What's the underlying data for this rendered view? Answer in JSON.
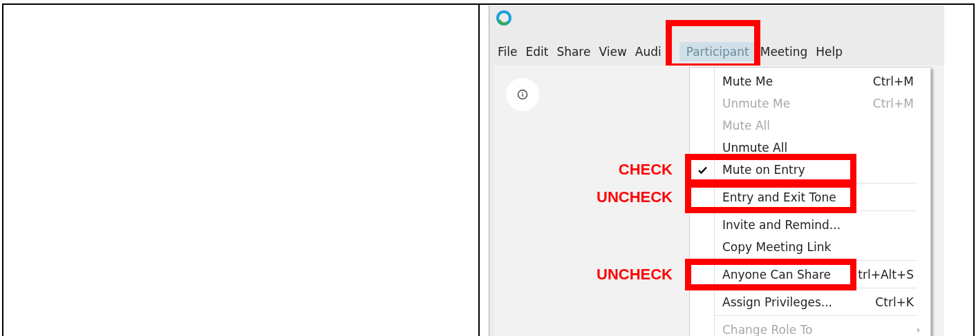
{
  "app": {
    "menu_bar": [
      {
        "label": "File",
        "selected": false,
        "highlighted": false
      },
      {
        "label": "Edit",
        "selected": false,
        "highlighted": false
      },
      {
        "label": "Share",
        "selected": false,
        "highlighted": false
      },
      {
        "label": "View",
        "selected": false,
        "highlighted": false
      },
      {
        "label": "Audi",
        "selected": false,
        "highlighted": false
      },
      {
        "label": "Participant",
        "selected": true,
        "highlighted": true
      },
      {
        "label": "Meeting",
        "selected": false,
        "highlighted": false
      },
      {
        "label": "Help",
        "selected": false,
        "highlighted": false
      }
    ],
    "participant_menu": [
      {
        "kind": "item",
        "label": "Mute Me",
        "shortcut": "Ctrl+M",
        "disabled": false,
        "checked": false,
        "submenu": false,
        "highlighted": false
      },
      {
        "kind": "item",
        "label": "Unmute Me",
        "shortcut": "Ctrl+M",
        "disabled": true,
        "checked": false,
        "submenu": false,
        "highlighted": false
      },
      {
        "kind": "item",
        "label": "Mute All",
        "disabled": true,
        "checked": false,
        "submenu": false,
        "highlighted": false
      },
      {
        "kind": "item",
        "label": "Unmute All",
        "disabled": false,
        "checked": false,
        "submenu": false,
        "highlighted": false
      },
      {
        "kind": "item",
        "label": "Mute on Entry",
        "disabled": false,
        "checked": true,
        "submenu": false,
        "highlighted": true,
        "annotation": "CHECK"
      },
      {
        "kind": "separator"
      },
      {
        "kind": "item",
        "label": "Entry and Exit Tone",
        "disabled": false,
        "checked": false,
        "submenu": false,
        "highlighted": true,
        "annotation": "UNCHECK"
      },
      {
        "kind": "separator"
      },
      {
        "kind": "item",
        "label": "Invite and Remind...",
        "disabled": false,
        "checked": false,
        "submenu": false,
        "highlighted": false
      },
      {
        "kind": "item",
        "label": "Copy Meeting Link",
        "disabled": false,
        "checked": false,
        "submenu": false,
        "highlighted": false
      },
      {
        "kind": "separator"
      },
      {
        "kind": "item",
        "label": "Anyone Can Share",
        "shortcut": "trl+Alt+S",
        "disabled": false,
        "checked": false,
        "submenu": false,
        "highlighted": true,
        "annotation": "UNCHECK"
      },
      {
        "kind": "separator"
      },
      {
        "kind": "item",
        "label": "Assign Privileges...",
        "shortcut": "Ctrl+K",
        "disabled": false,
        "checked": false,
        "submenu": false,
        "highlighted": false
      },
      {
        "kind": "separator"
      },
      {
        "kind": "item",
        "label": "Change Role To",
        "disabled": true,
        "checked": false,
        "submenu": true,
        "highlighted": false
      }
    ]
  }
}
